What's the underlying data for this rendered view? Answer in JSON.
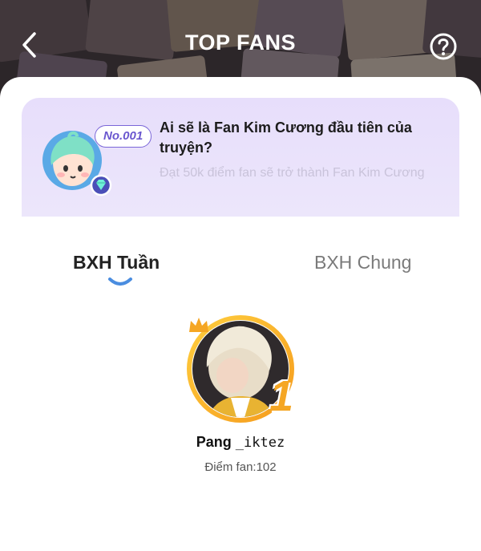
{
  "header": {
    "title": "TOP FANS",
    "back_icon": "chevron-left-icon",
    "help_icon": "question-circle-icon"
  },
  "banner": {
    "rank_badge": "No.001",
    "title": "Ai sẽ là Fan Kim Cương đầu tiên của truyện?",
    "description": "Đạt 50k điểm fan sẽ trở thành Fan Kim Cương",
    "avatar_icon": "mascot-avatar",
    "diamond_icon": "diamond-badge-icon"
  },
  "tabs": [
    {
      "label": "BXH Tuần",
      "active": true
    },
    {
      "label": "BXH Chung",
      "active": false
    }
  ],
  "top_fan": {
    "rank": "1",
    "name_part1": "Pang ",
    "name_part2": "_iktez",
    "points_label": "Điểm fan:102",
    "avatar": "user-photo-avatar",
    "crown_icon": "crown-icon"
  },
  "colors": {
    "banner_bg": "#e7defb",
    "accent_purple": "#6a57cf",
    "tab_indicator": "#4a8de0",
    "gold": "#f5a623"
  }
}
